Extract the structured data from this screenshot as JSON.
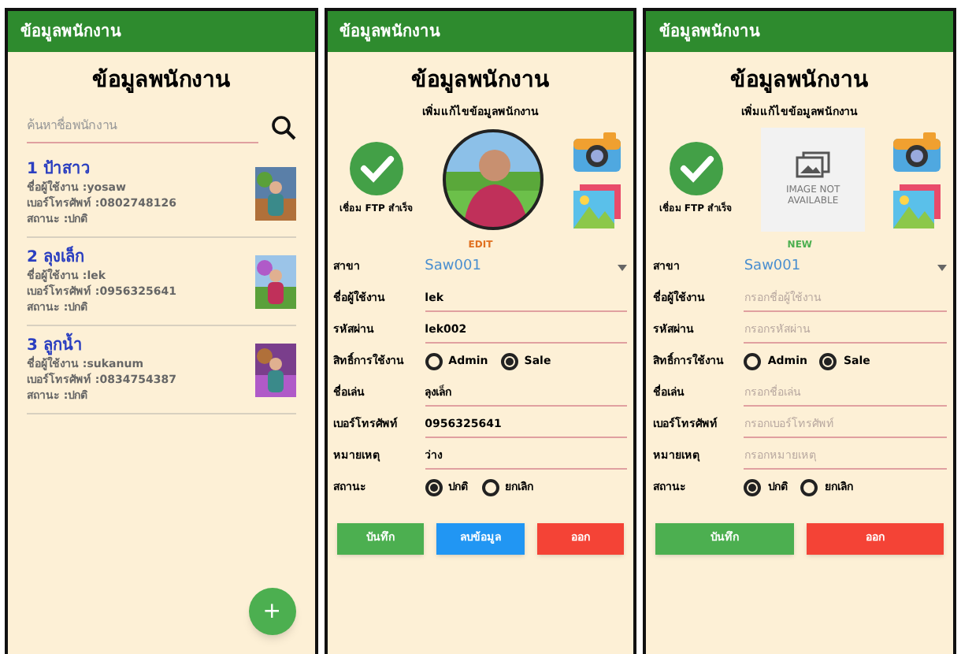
{
  "screens": [
    {
      "kind": "list",
      "app_bar": "ข้อมูลพนักงาน",
      "title": "ข้อมูลพนักงาน",
      "search": {
        "placeholder": "ค้นหาชื่อพนักงาน"
      },
      "employees": [
        {
          "name": "1 ป้าสาว",
          "username": "ชื่อผู้ใช้งาน :yosaw",
          "phone": "เบอร์โทรศัพท์ :0802748126",
          "status": "สถานะ :ปกติ"
        },
        {
          "name": "2 ลุงเล็ก",
          "username": "ชื่อผู้ใช้งาน :lek",
          "phone": "เบอร์โทรศัพท์ :0956325641",
          "status": "สถานะ :ปกติ"
        },
        {
          "name": "3 ลูกน้ำ",
          "username": "ชื่อผู้ใช้งาน :sukanum",
          "phone": "เบอร์โทรศัพท์ :0834754387",
          "status": "สถานะ :ปกติ"
        }
      ],
      "fab": "+"
    },
    {
      "kind": "form",
      "app_bar": "ข้อมูลพนักงาน",
      "title": "ข้อมูลพนักงาน",
      "subtitle": "เพิ่มแก้ไขข้อมูลพนักงาน",
      "ftp_status": "เชื่อม FTP สำเร็จ",
      "mode": "EDIT",
      "fields": [
        {
          "kind": "select",
          "label": "สาขา",
          "value": "Saw001"
        },
        {
          "kind": "text",
          "label": "ชื่อผู้ใช้งาน",
          "value": "lek"
        },
        {
          "kind": "text",
          "label": "รหัสผ่าน",
          "value": "lek002"
        },
        {
          "kind": "radio",
          "label": "สิทธิ์การใช้งาน",
          "options": [
            {
              "label": "Admin",
              "selected": false
            },
            {
              "label": "Sale",
              "selected": true
            }
          ]
        },
        {
          "kind": "text",
          "label": "ชื่อเล่น",
          "value": "ลุงเล็ก"
        },
        {
          "kind": "text",
          "label": "เบอร์โทรศัพท์",
          "value": "0956325641"
        },
        {
          "kind": "text",
          "label": "หมายเหตุ",
          "value": "ว่าง"
        },
        {
          "kind": "radio",
          "label": "สถานะ",
          "options": [
            {
              "label": "ปกติ",
              "selected": true
            },
            {
              "label": "ยกเลิก",
              "selected": false
            }
          ]
        }
      ],
      "buttons": [
        {
          "label": "บันทึก",
          "color": "#4caf50"
        },
        {
          "label": "ลบข้อมูล",
          "color": "#2196f3"
        },
        {
          "label": "ออก",
          "color": "#f44336"
        }
      ]
    },
    {
      "kind": "form",
      "app_bar": "ข้อมูลพนักงาน",
      "title": "ข้อมูลพนักงาน",
      "subtitle": "เพิ่มแก้ไขข้อมูลพนักงาน",
      "ftp_status": "เชื่อม FTP สำเร็จ",
      "photo": {
        "kind": "unavailable",
        "text": "IMAGE NOT AVAILABLE"
      },
      "mode": "NEW",
      "fields": [
        {
          "kind": "select",
          "label": "สาขา",
          "value": "Saw001"
        },
        {
          "kind": "text",
          "label": "ชื่อผู้ใช้งาน",
          "placeholder": "กรอกชื่อผู้ใช้งาน"
        },
        {
          "kind": "text",
          "label": "รหัสผ่าน",
          "placeholder": "กรอกรหัสผ่าน"
        },
        {
          "kind": "radio",
          "label": "สิทธิ์การใช้งาน",
          "options": [
            {
              "label": "Admin",
              "selected": false
            },
            {
              "label": "Sale",
              "selected": true
            }
          ]
        },
        {
          "kind": "text",
          "label": "ชื่อเล่น",
          "placeholder": "กรอกชื่อเล่น"
        },
        {
          "kind": "text",
          "label": "เบอร์โทรศัพท์",
          "placeholder": "กรอกเบอร์โทรศัพท์"
        },
        {
          "kind": "text",
          "label": "หมายเหตุ",
          "placeholder": "กรอกหมายเหตุ"
        },
        {
          "kind": "radio",
          "label": "สถานะ",
          "options": [
            {
              "label": "ปกติ",
              "selected": true
            },
            {
              "label": "ยกเลิก",
              "selected": false
            }
          ]
        }
      ],
      "buttons": [
        {
          "label": "บันทึก",
          "color": "#4caf50"
        },
        {
          "label": "ออก",
          "color": "#f44336"
        }
      ]
    }
  ]
}
